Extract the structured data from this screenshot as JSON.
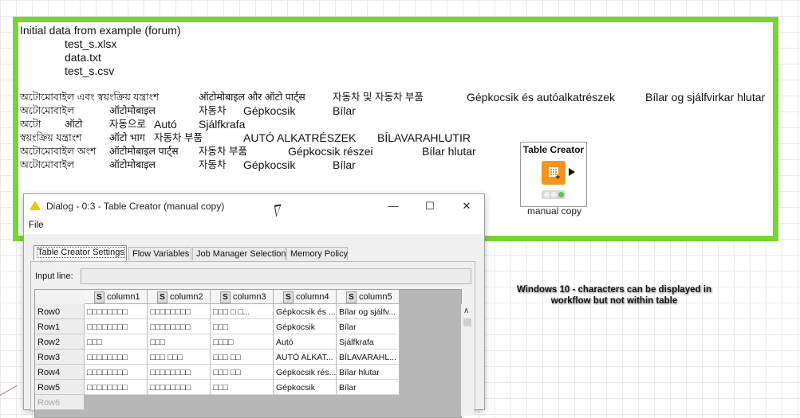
{
  "annotation": {
    "title": "Initial data from example (forum)",
    "files": [
      "test_s.xlsx",
      "data.txt",
      "test_s.csv"
    ],
    "lines": [
      [
        "অটোমোবাইল এবং স্বয়ংক্রিয় যন্ত্রাংশ",
        "ऑटोमोबाइल और ऑटो पार्ट्स",
        "자동차 및 자동차 부품",
        "Gépkocsik és autóalkatrészek",
        "Bílar og sjálfvirkar hlutar"
      ],
      [
        "অটোমোবাইল",
        "ऑटोमोबाइल",
        "자동차",
        "Gépkocsik",
        "Bílar"
      ],
      [
        "অটো",
        "ऑटो",
        "자동으로",
        "Autó",
        "Sjálfkrafa"
      ],
      [
        "স্বয়ংক্রিয় যন্ত্রাংশ",
        "ऑटो भाग",
        "자동차 부품",
        "AUTÓ ALKATRÉSZEK",
        "BÍLAVARAHLUTIR"
      ],
      [
        "অটোমোবাইল অংশ",
        "ऑटोमोबाइल पार्ट्स",
        "자동차 부품",
        "Gépkocsik részei",
        "Bílar hlutar"
      ],
      [
        "অটোমোবাইল",
        "ऑटोमोबाइल",
        "자동차",
        "Gépkocsik",
        "Bílar"
      ]
    ]
  },
  "node": {
    "title": "Table Creator",
    "label": "manual copy",
    "icon": "table-creator-icon",
    "status_colors": [
      "#f2f2f2",
      "#f2f2f2",
      "#5fc24a"
    ]
  },
  "dialog": {
    "title": "Dialog - 0:3 - Table Creator (manual copy)",
    "menu_file": "File",
    "minimize": "—",
    "maximize": "☐",
    "close": "✕",
    "tabs": [
      "Table Creator Settings",
      "Flow Variables",
      "Job Manager Selection",
      "Memory Policy"
    ],
    "input_label": "Input line:",
    "type_badge": "S",
    "columns": [
      "column1",
      "column2",
      "column3",
      "column4",
      "column5"
    ],
    "rows": [
      {
        "name": "Row0",
        "cells": [
          "□□□□□□□□",
          "□□□□□□□□",
          "□□□ □ □...",
          "Gépkocsik és ...",
          "Bílar og sjálfv..."
        ]
      },
      {
        "name": "Row1",
        "cells": [
          "□□□□□□□□",
          "□□□□□□□□",
          "□□□",
          "Gépkocsik",
          "Bílar"
        ]
      },
      {
        "name": "Row2",
        "cells": [
          "□□□",
          "□□□",
          "□□□□",
          "Autó",
          "Sjálfkrafa"
        ]
      },
      {
        "name": "Row3",
        "cells": [
          "□□□□□□□□",
          "□□□ □□□",
          "□□□ □□",
          "AUTÓ ALKAT...",
          "BÍLAVARAHL..."
        ]
      },
      {
        "name": "Row4",
        "cells": [
          "□□□□□□□□",
          "□□□□□□□□",
          "□□□ □□",
          "Gépkocsik rés...",
          "Bílar hlutar"
        ]
      },
      {
        "name": "Row5",
        "cells": [
          "□□□□□□□□",
          "□□□□□□□□",
          "□□□",
          "Gépkocsik",
          "Bílar"
        ]
      },
      {
        "name": "Row6",
        "cells": [
          "",
          "",
          "",
          "",
          ""
        ]
      }
    ]
  },
  "note": {
    "line1": "Windows 10 - characters can be displayed in",
    "line2": "workflow but not within table"
  }
}
